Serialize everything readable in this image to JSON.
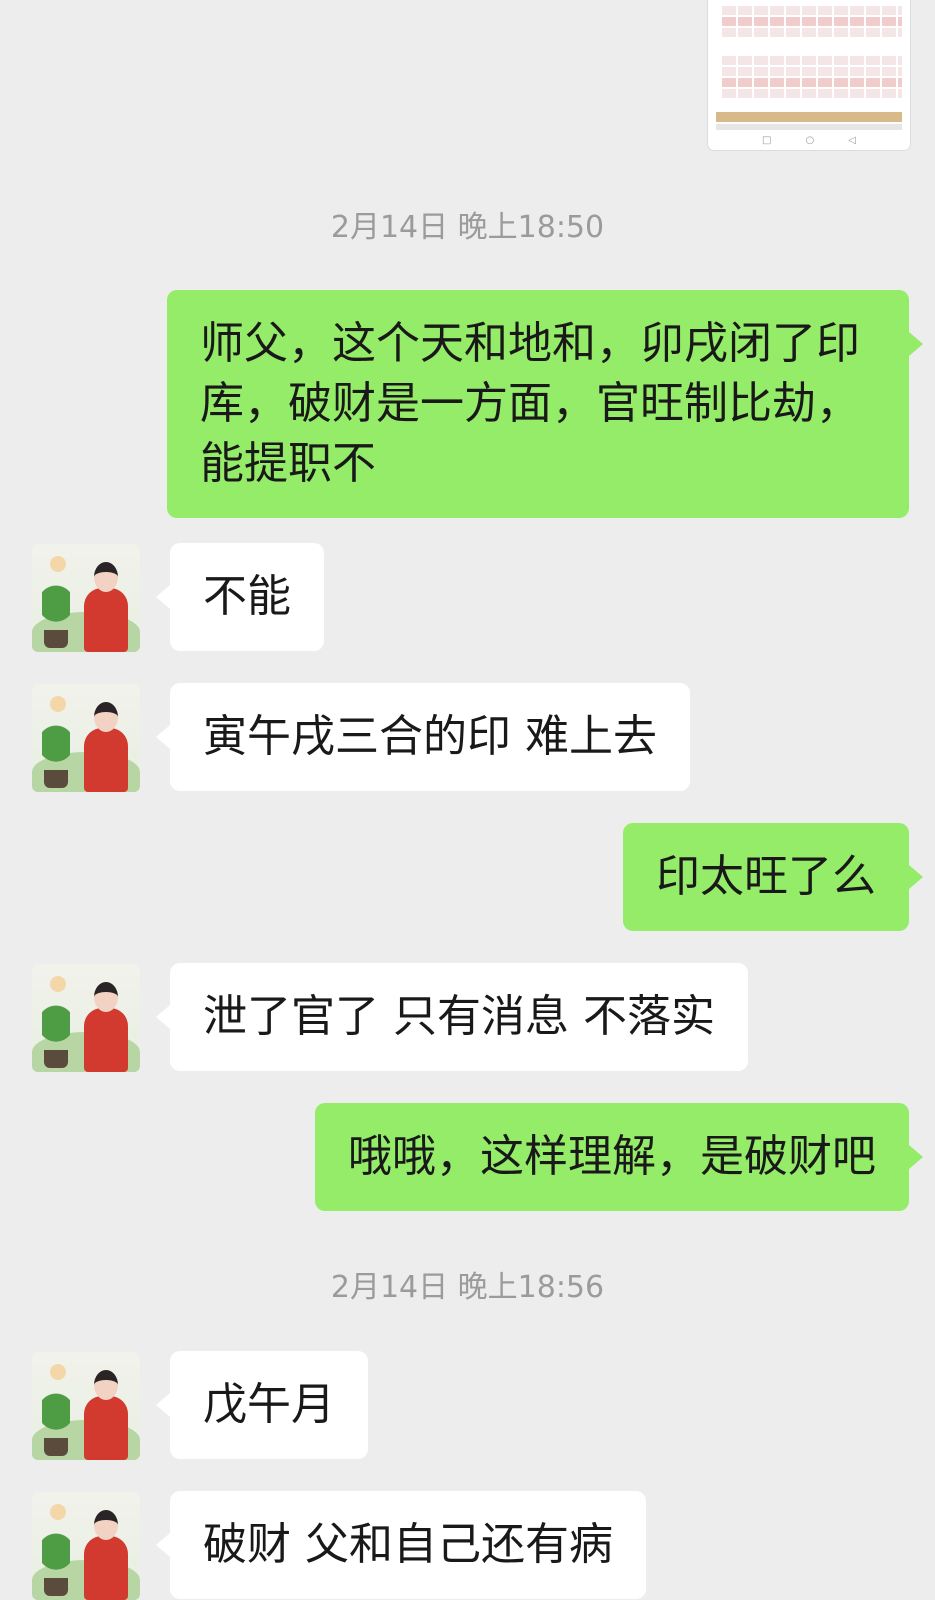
{
  "messages": [
    {
      "type": "time",
      "text": "2月14日 晚上18:50"
    },
    {
      "from": "me",
      "text": "师父，这个天和地和，卯戌闭了印库，破财是一方面，官旺制比劫，能提职不"
    },
    {
      "from": "other",
      "text": "不能"
    },
    {
      "from": "other",
      "text": "寅午戌三合的印 难上去"
    },
    {
      "from": "me",
      "text": "印太旺了么"
    },
    {
      "from": "other",
      "text": "泄了官了 只有消息 不落实"
    },
    {
      "from": "me",
      "text": "哦哦，这样理解，是破财吧"
    },
    {
      "type": "time",
      "text": "2月14日 晚上18:56"
    },
    {
      "from": "other",
      "text": "戊午月"
    },
    {
      "from": "other",
      "text": "破财 父和自己还有病"
    }
  ]
}
